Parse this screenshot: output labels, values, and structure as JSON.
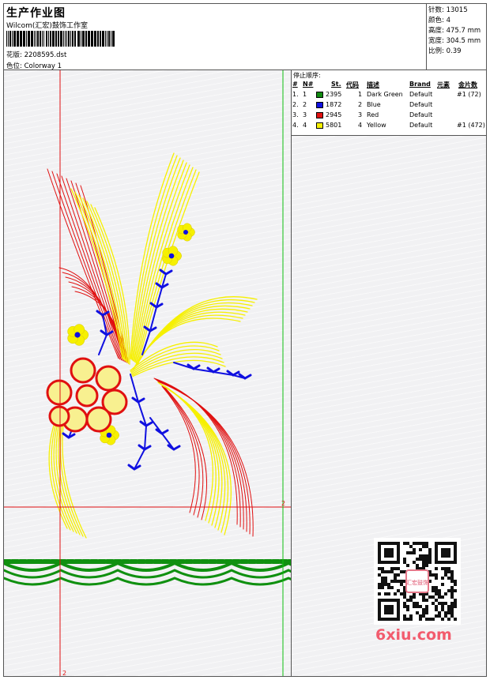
{
  "header": {
    "title": "生产作业图",
    "company": "Wilcom(汇宏)鼓饰工作室",
    "design_label": "花版:",
    "design_value": "2208595.dst",
    "colorway_label": "色位:",
    "colorway_value": "Colorway 1"
  },
  "stats": [
    {
      "label": "针数:",
      "value": "13015"
    },
    {
      "label": "颜色:",
      "value": "4"
    },
    {
      "label": "高度:",
      "value": "475.7 mm"
    },
    {
      "label": "宽度:",
      "value": "304.5 mm"
    },
    {
      "label": "比例:",
      "value": "0.39"
    }
  ],
  "stop_sequence": {
    "title": "停止顺序:",
    "columns": [
      "#",
      "N#",
      "St.",
      "代码",
      "描述",
      "Brand",
      "元素",
      "金片数"
    ],
    "rows": [
      {
        "num": "1.",
        "n": "1",
        "color": "#108a10",
        "st": "2395",
        "code": "1",
        "desc": "Dark Green",
        "brand": "Default",
        "elem": "",
        "seq": "#1 (72)"
      },
      {
        "num": "2.",
        "n": "2",
        "color": "#1010e0",
        "st": "1872",
        "code": "2",
        "desc": "Blue",
        "brand": "Default",
        "elem": "",
        "seq": ""
      },
      {
        "num": "3.",
        "n": "3",
        "color": "#e01010",
        "st": "2945",
        "code": "3",
        "desc": "Red",
        "brand": "Default",
        "elem": "",
        "seq": ""
      },
      {
        "num": "4.",
        "n": "4",
        "color": "#f6f000",
        "st": "5801",
        "code": "4",
        "desc": "Yellow",
        "brand": "Default",
        "elem": "",
        "seq": "#1 (472)"
      }
    ]
  },
  "canvas": {
    "markers": {
      "right": "2",
      "bottom": "2"
    },
    "colors": {
      "green": "#109010",
      "blue": "#1010e0",
      "red": "#e01010",
      "yellow": "#f6f000"
    }
  },
  "watermark": "6xiu.com",
  "qr_badge_text": "汇宏鼓饰"
}
